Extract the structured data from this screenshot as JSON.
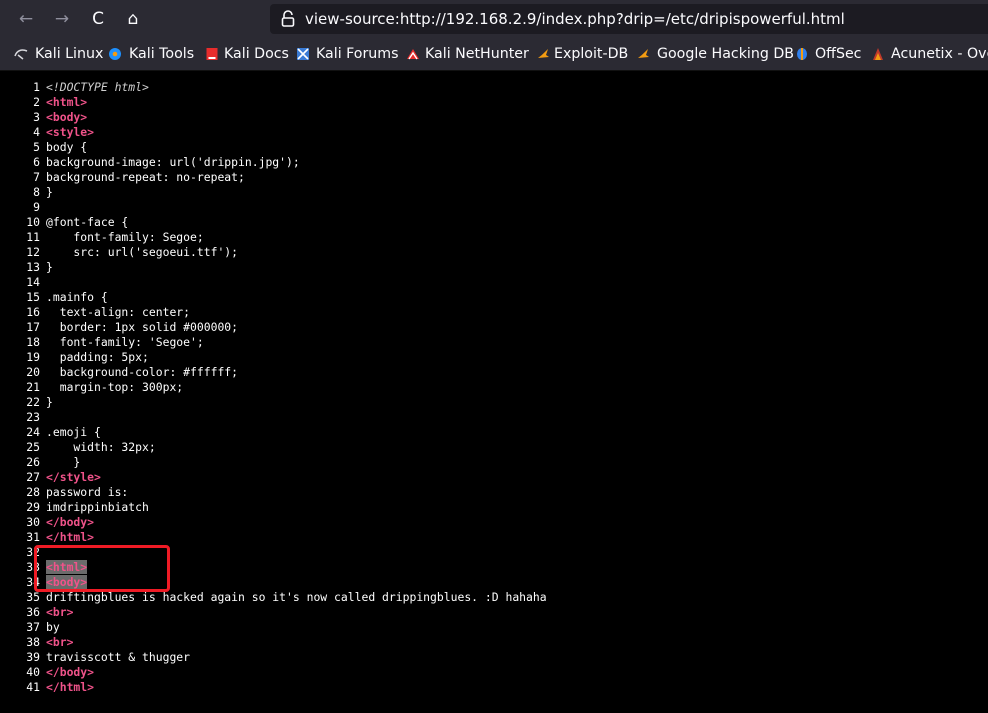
{
  "toolbar": {
    "back": "←",
    "forward": "→",
    "reload": "C",
    "home": "⌂",
    "url": "view-source:http://192.168.2.9/index.php?drip=/etc/dripispowerful.html"
  },
  "bookmarks": [
    {
      "label": "Kali Linux",
      "icon": "kali-dragon-icon"
    },
    {
      "label": "Kali Tools",
      "icon": "kali-tools-icon"
    },
    {
      "label": "Kali Docs",
      "icon": "kali-docs-icon"
    },
    {
      "label": "Kali Forums",
      "icon": "kali-forums-icon"
    },
    {
      "label": "Kali NetHunter",
      "icon": "kali-nethunter-icon"
    },
    {
      "label": "Exploit-DB",
      "icon": "exploit-db-icon"
    },
    {
      "label": "Google Hacking DB",
      "icon": "google-hacking-db-icon"
    },
    {
      "label": "OffSec",
      "icon": "offsec-icon"
    },
    {
      "label": "Acunetix - Over",
      "icon": "acunetix-icon"
    }
  ],
  "source": {
    "lines": [
      [
        "1",
        "<!DOCTYPE html>"
      ],
      [
        "2",
        "<html>"
      ],
      [
        "3",
        "<body>"
      ],
      [
        "4",
        "<style>"
      ],
      [
        "5",
        "body {"
      ],
      [
        "6",
        "background-image: url('drippin.jpg');"
      ],
      [
        "7",
        "background-repeat: no-repeat;"
      ],
      [
        "8",
        "}"
      ],
      [
        "9",
        ""
      ],
      [
        "10",
        "@font-face {"
      ],
      [
        "11",
        "    font-family: Segoe;"
      ],
      [
        "12",
        "    src: url('segoeui.ttf');"
      ],
      [
        "13",
        "}"
      ],
      [
        "14",
        ""
      ],
      [
        "15",
        ".mainfo {"
      ],
      [
        "16",
        "  text-align: center;"
      ],
      [
        "17",
        "  border: 1px solid #000000;"
      ],
      [
        "18",
        "  font-family: 'Segoe';"
      ],
      [
        "19",
        "  padding: 5px;"
      ],
      [
        "20",
        "  background-color: #ffffff;"
      ],
      [
        "21",
        "  margin-top: 300px;"
      ],
      [
        "22",
        "}"
      ],
      [
        "23",
        ""
      ],
      [
        "24",
        ".emoji {"
      ],
      [
        "25",
        "    width: 32px;"
      ],
      [
        "26",
        "    }"
      ],
      [
        "27",
        "</style>"
      ],
      [
        "28",
        "password is:"
      ],
      [
        "29",
        "imdrippinbiatch"
      ],
      [
        "30",
        "</body>"
      ],
      [
        "31",
        "</html>"
      ],
      [
        "32",
        ""
      ],
      [
        "33",
        "<html>"
      ],
      [
        "34",
        "<body>"
      ],
      [
        "35",
        "driftingblues is hacked again so it's now called drippingblues. :D hahaha"
      ],
      [
        "36",
        "<br>"
      ],
      [
        "37",
        "by"
      ],
      [
        "38",
        "<br>"
      ],
      [
        "39",
        "travisscott & thugger"
      ],
      [
        "40",
        "</body>"
      ],
      [
        "41",
        "</html>"
      ]
    ]
  },
  "colors": {
    "tag": "#f0538a",
    "annotation": "#ef1b25",
    "toolbar_bg": "#2b2a33",
    "source_bg": "#000000"
  }
}
